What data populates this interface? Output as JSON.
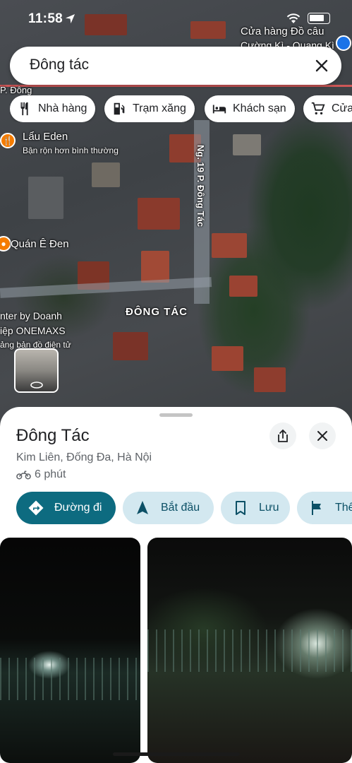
{
  "status_bar": {
    "time": "11:58"
  },
  "search": {
    "query": "Đông tác"
  },
  "chips": [
    {
      "label": "Nhà hàng",
      "icon": "restaurant-icon"
    },
    {
      "label": "Trạm xăng",
      "icon": "gas-station-icon"
    },
    {
      "label": "Khách sạn",
      "icon": "hotel-icon"
    },
    {
      "label": "Cửa",
      "icon": "shopping-cart-icon"
    }
  ],
  "map": {
    "pois": [
      {
        "name": "Lẩu Eden",
        "subtitle": "Bận rộn hơn bình thường"
      },
      {
        "name": "Quán Ê Đen"
      },
      {
        "name": "Cửa hàng Đồ câu",
        "subtitle": "Cường Kì - Quang Kì"
      }
    ],
    "street_label": "Ng. 19 P. Đông Tác",
    "street_label_top": "P. Đông",
    "area_label": "ĐÔNG TÁC",
    "edge_labels": [
      "nter by Doanh",
      "iệp ONEMAXS",
      "ảng bản đồ điện tử"
    ]
  },
  "place": {
    "name": "Đông Tác",
    "address": "Kim Liên, Đống Đa, Hà Nội",
    "travel_time": "6 phút"
  },
  "actions": [
    {
      "label": "Đường đi",
      "icon": "directions-icon"
    },
    {
      "label": "Bắt đầu",
      "icon": "navigation-arrow-icon"
    },
    {
      "label": "Lưu",
      "icon": "bookmark-icon"
    },
    {
      "label": "Thê",
      "icon": "flag-icon"
    }
  ],
  "colors": {
    "primary_action": "#0d6b80",
    "secondary_action": "#d3e8f0",
    "poi_orange": "#f57c00"
  }
}
